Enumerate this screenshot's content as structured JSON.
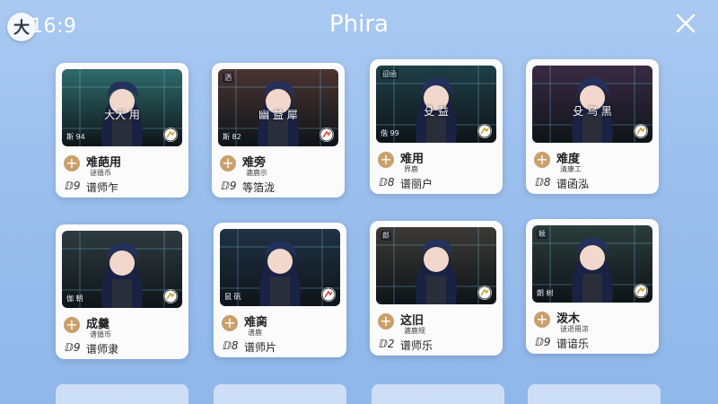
{
  "header": {
    "logo_text": "大",
    "clock": "16:9",
    "title": "Phira"
  },
  "cards": [
    {
      "name": "难葩用",
      "subtitle": "谜循币",
      "level": "ⅅ9",
      "charter": "谱师乍",
      "overlay": "大犬 用",
      "corner": "",
      "label": "斯 94",
      "accent": "#2f6b6b",
      "icon_color": "#c9a43a"
    },
    {
      "name": "难旁",
      "subtitle": "漉鹿示",
      "level": "ⅅ9",
      "charter": "等箔泷",
      "overlay": "幽 益 犀",
      "corner": "洒",
      "label": "斯 82",
      "accent": "#4a3432",
      "icon_color": "#d44a3a"
    },
    {
      "name": "难用",
      "subtitle": "界鹿",
      "level": "ⅅ8",
      "charter": "谱丽户",
      "overlay": "殳 益",
      "corner": "迎函",
      "label": "偕 99",
      "accent": "#1f3f47",
      "icon_color": "#c9a43a"
    },
    {
      "name": "难度",
      "subtitle": "清康工",
      "level": "ⅅ8",
      "charter": "谱函泓",
      "overlay": "殳 乌 黑",
      "corner": "",
      "label": "",
      "accent": "#3a2a44",
      "icon_color": "#c9a43a"
    },
    {
      "name": "成羹",
      "subtitle": "谱循币",
      "level": "ⅅ9",
      "charter": "谱师隶",
      "overlay": "",
      "corner": "",
      "label": "伽 朝",
      "accent": "#2f3b3f",
      "icon_color": "#c9a43a"
    },
    {
      "name": "难脔",
      "subtitle": "谱鹿",
      "level": "ⅅ8",
      "charter": "谱师片",
      "overlay": "",
      "corner": "",
      "label": "鼠 矾",
      "accent": "#203244",
      "icon_color": "#d44a3a"
    },
    {
      "name": "这旧",
      "subtitle": "漉鹿规",
      "level": "ⅅ2",
      "charter": "谱师乐",
      "overlay": "",
      "corner": "郎",
      "label": "",
      "accent": "#3c3a35",
      "icon_color": "#c9a43a"
    },
    {
      "name": "泼木",
      "subtitle": "谜逝冊凉",
      "level": "ⅅ9",
      "charter": "谱谙乐",
      "overlay": "",
      "corner": "颖",
      "label": "朗 树",
      "accent": "#2b3d3b",
      "icon_color": "#c9a43a"
    }
  ]
}
